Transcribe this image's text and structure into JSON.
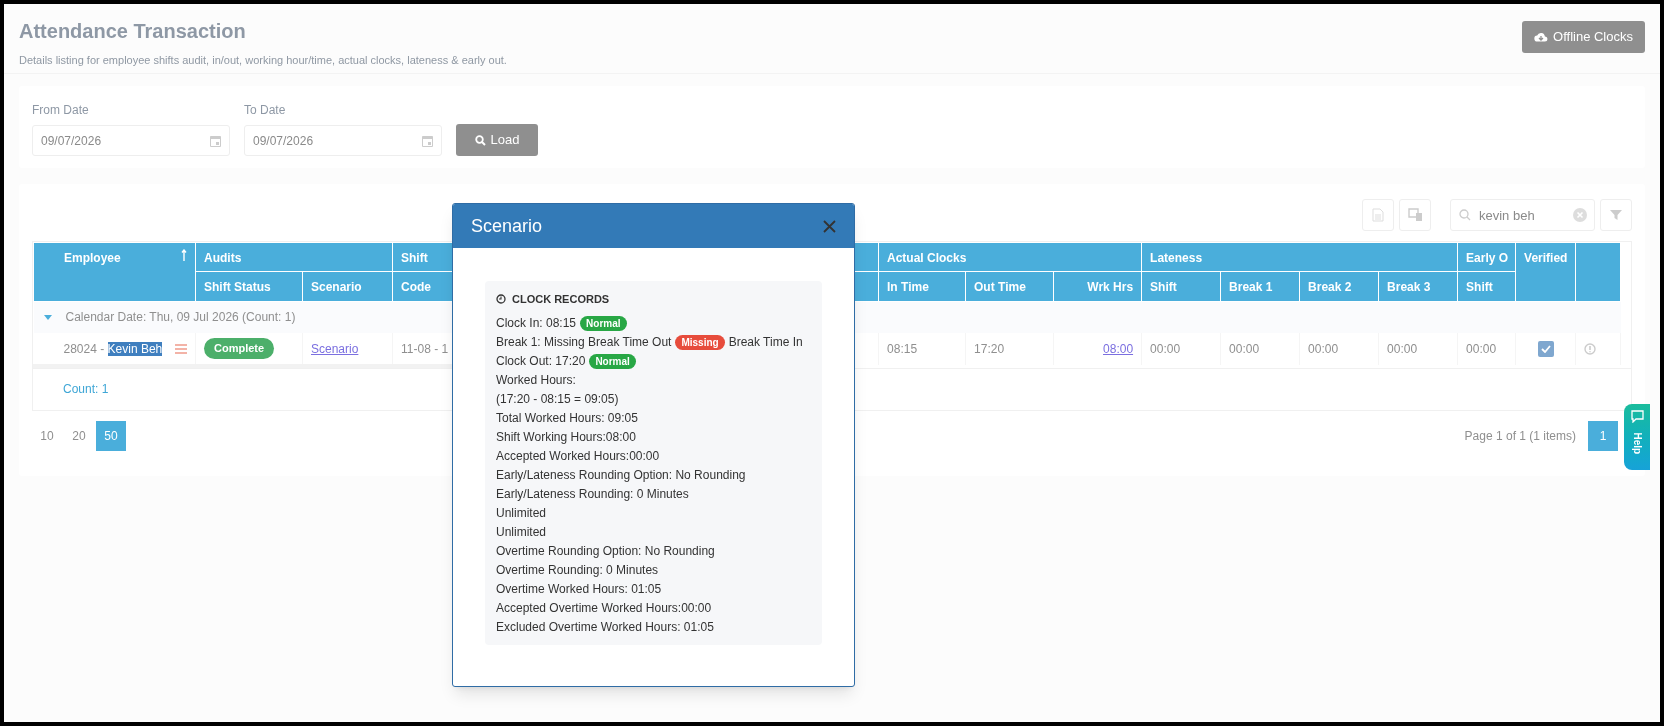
{
  "page": {
    "title": "Attendance Transaction",
    "subtitle": "Details listing for employee shifts audit, in/out, working hour/time, actual clocks, lateness & early out.",
    "offline_button": "Offline Clocks"
  },
  "filters": {
    "fields": [
      {
        "label": "From Date",
        "value": "09/07/2026"
      },
      {
        "label": "To Date",
        "value": "09/07/2026"
      }
    ],
    "load_button": "Load"
  },
  "toolbar": {
    "search": "kevin beh"
  },
  "table": {
    "group_headers": [
      "Employee",
      "Audits",
      "Shift",
      "Actual Clocks",
      "Lateness",
      "Early O",
      "Verified"
    ],
    "columns": [
      "Shift Status",
      "Scenario",
      "Code",
      "In Time",
      "Out Time",
      "Wrk Hrs",
      "Shift",
      "Break 1",
      "Break 2",
      "Break 3",
      "Shift"
    ],
    "group_row": "Calendar Date: Thu, 09 Jul 2026 (Count: 1)",
    "rows": [
      {
        "employee_prefix": "28024 - ",
        "employee_name": "Kevin Beh",
        "name_highlighted": true,
        "shift_status": "Complete",
        "scenario": "Scenario",
        "code": "11-08 - 1",
        "in_time": "08:15",
        "out_time": "17:20",
        "wrk_hrs": "08:00",
        "late_shift": "00:00",
        "late_break_1": "00:00",
        "late_break_2": "00:00",
        "late_break_3": "00:00",
        "early_shift": "00:00",
        "verified": true
      }
    ],
    "footer": "Count: 1"
  },
  "pagination": {
    "sizes": [
      {
        "label": "10",
        "selected": false
      },
      {
        "label": "20",
        "selected": false
      },
      {
        "label": "50",
        "selected": true
      }
    ],
    "info": "Page 1 of 1 (1 items)",
    "pages": [
      {
        "label": "1",
        "selected": true
      }
    ]
  },
  "help_tab": "Help",
  "modal": {
    "title": "Scenario",
    "section": "CLOCK RECORDS",
    "lines": [
      [
        {
          "kind": "text",
          "text": "Clock In: 08:15"
        },
        {
          "kind": "badge",
          "text": "Normal",
          "color": "#28a745"
        }
      ],
      [
        {
          "kind": "text",
          "text": "Break 1: Missing Break Time Out"
        },
        {
          "kind": "badge",
          "text": "Missing",
          "color": "#e74c3c"
        },
        {
          "kind": "text",
          "text": "Break Time In"
        }
      ],
      [
        {
          "kind": "text",
          "text": "Clock Out: 17:20"
        },
        {
          "kind": "badge",
          "text": "Normal",
          "color": "#28a745"
        }
      ],
      [
        {
          "kind": "text",
          "text": "Worked Hours:"
        }
      ],
      [
        {
          "kind": "text",
          "text": "(17:20 - 08:15 = 09:05)"
        }
      ],
      [
        {
          "kind": "text",
          "text": "Total Worked Hours: 09:05"
        }
      ],
      [
        {
          "kind": "text",
          "text": "Shift Working Hours:08:00"
        }
      ],
      [
        {
          "kind": "text",
          "text": "Accepted Worked Hours:00:00"
        }
      ],
      [
        {
          "kind": "text",
          "text": "Early/Lateness Rounding Option: No Rounding"
        }
      ],
      [
        {
          "kind": "text",
          "text": "Early/Lateness Rounding: 0 Minutes"
        }
      ],
      [
        {
          "kind": "text",
          "text": "Unlimited"
        }
      ],
      [
        {
          "kind": "text",
          "text": "Unlimited"
        }
      ],
      [
        {
          "kind": "text",
          "text": "Overtime Rounding Option: No Rounding"
        }
      ],
      [
        {
          "kind": "text",
          "text": "Overtime Rounding: 0 Minutes"
        }
      ],
      [
        {
          "kind": "text",
          "text": "Overtime Worked Hours: 01:05"
        }
      ],
      [
        {
          "kind": "text",
          "text": "Accepted Overtime Worked Hours:00:00"
        }
      ],
      [
        {
          "kind": "text",
          "text": "Excluded Overtime Worked Hours: 01:05"
        }
      ]
    ]
  }
}
